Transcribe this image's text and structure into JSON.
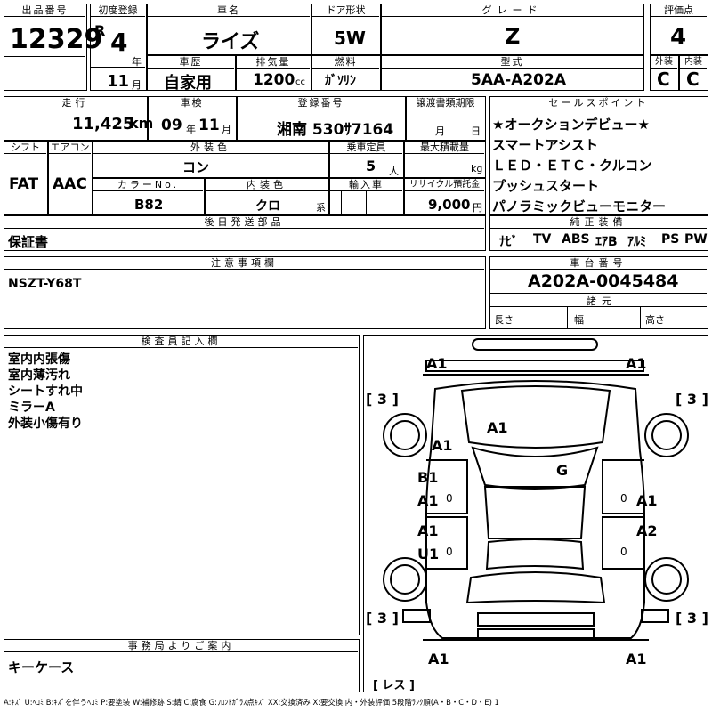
{
  "labels": {
    "lot_no": "出品番号",
    "first_reg": "初度登録",
    "car_name": "車名",
    "door": "ドア形状",
    "grade": "グレード",
    "score": "評価点",
    "history": "車歴",
    "displacement": "排気量",
    "fuel": "燃料",
    "model": "型式",
    "exterior": "外装",
    "interior": "内装",
    "mileage": "走行",
    "inspection": "車検",
    "reg_no": "登録番号",
    "transfer_deadline": "譲渡書類期限",
    "sales_points": "セールスポイント",
    "shift": "シフト",
    "aircon": "エアコン",
    "ext_color": "外装色",
    "capacity": "乗車定員",
    "max_load": "最大積載量",
    "color_no": "カラーNo.",
    "int_color": "内装色",
    "import": "輸入車",
    "recycle": "リサイクル預託金",
    "later_parts": "後日発送部品",
    "genuine_equipment": "純正装備",
    "notes": "注意事項欄",
    "chassis_no": "車台番号",
    "dimensions": "諸元",
    "length": "長さ",
    "width": "幅",
    "height": "高さ",
    "inspector": "検査員記入欄",
    "office": "事務局よりご案内",
    "unit_year": "年",
    "unit_month": "月",
    "unit_cc": "cc",
    "unit_km": "km",
    "unit_person": "人",
    "unit_kg": "kg",
    "unit_kei": "系",
    "unit_yen": "円"
  },
  "vehicle": {
    "lot_no": "12329",
    "era": "R",
    "reg_year": "4",
    "reg_month": "11",
    "car_name": "ライズ",
    "door": "5W",
    "grade": "Z",
    "score": "4",
    "history": "自家用",
    "displacement": "1200",
    "fuel": "ｶﾞｿﾘﾝ",
    "model": "5AA-A202A",
    "exterior_grade": "C",
    "interior_grade": "C",
    "mileage": "11,425",
    "inspection_year": "09",
    "inspection_month": "11",
    "reg_no": "湘南 530ｻ7164",
    "transfer_month_unit": "月",
    "transfer_day_unit": "日",
    "shift": "FAT",
    "aircon": "AAC",
    "ext_color": "コン",
    "capacity": "5",
    "color_no": "B82",
    "int_color": "クロ",
    "recycle": "9,000",
    "chassis_no": "A202A-0045484"
  },
  "sales_points": [
    "★オークションデビュー★",
    "スマートアシスト",
    "ＬＥＤ・ＥＴＣ・クルコン",
    "プッシュスタート",
    "パノラミックビューモニター"
  ],
  "genuine_equipment": [
    "ﾅﾋﾞ",
    "TV",
    "ABS",
    "ｴｱB",
    "ｱﾙﾐ",
    "PS",
    "PW"
  ],
  "later_parts": "保証書",
  "notes": "NSZT-Y68T",
  "inspector_notes": [
    "室内内張傷",
    "室内薄汚れ",
    "シートすれ中",
    "ミラーA",
    "外装小傷有り"
  ],
  "office_notes": "キーケース",
  "diagram": {
    "front_left": "A1",
    "front_right": "A1",
    "left_fender": "A1",
    "hood": "A1",
    "roof": "G",
    "front_door_left_1": "B1",
    "front_door_left_2": "A1",
    "front_door_right": "A1",
    "rear_door_left_1": "A1",
    "rear_door_left_2": "U1",
    "rear_door_right": "A2",
    "rear_left": "A1",
    "rear_right": "A1",
    "tire_fl": "[ 3 ]",
    "tire_fr": "[ 3 ]",
    "tire_rl": "[ 3 ]",
    "tire_rr": "[ 3 ]",
    "spare": "[ レス ]",
    "mark_0": "0"
  },
  "legend": "A:ｷｽﾞ U:ﾍｺﾐ B:ｷｽﾞを伴うﾍｺﾐ P:要塗装 W:補修跡 S:錆 C:腐食 G:ﾌﾛﾝﾄｶﾞﾗｽ点ｷｽﾞ XX:交換済み X:要交換 内・外装評価 5段階ﾗﾝｸ順(A・B・C・D・E) 1"
}
